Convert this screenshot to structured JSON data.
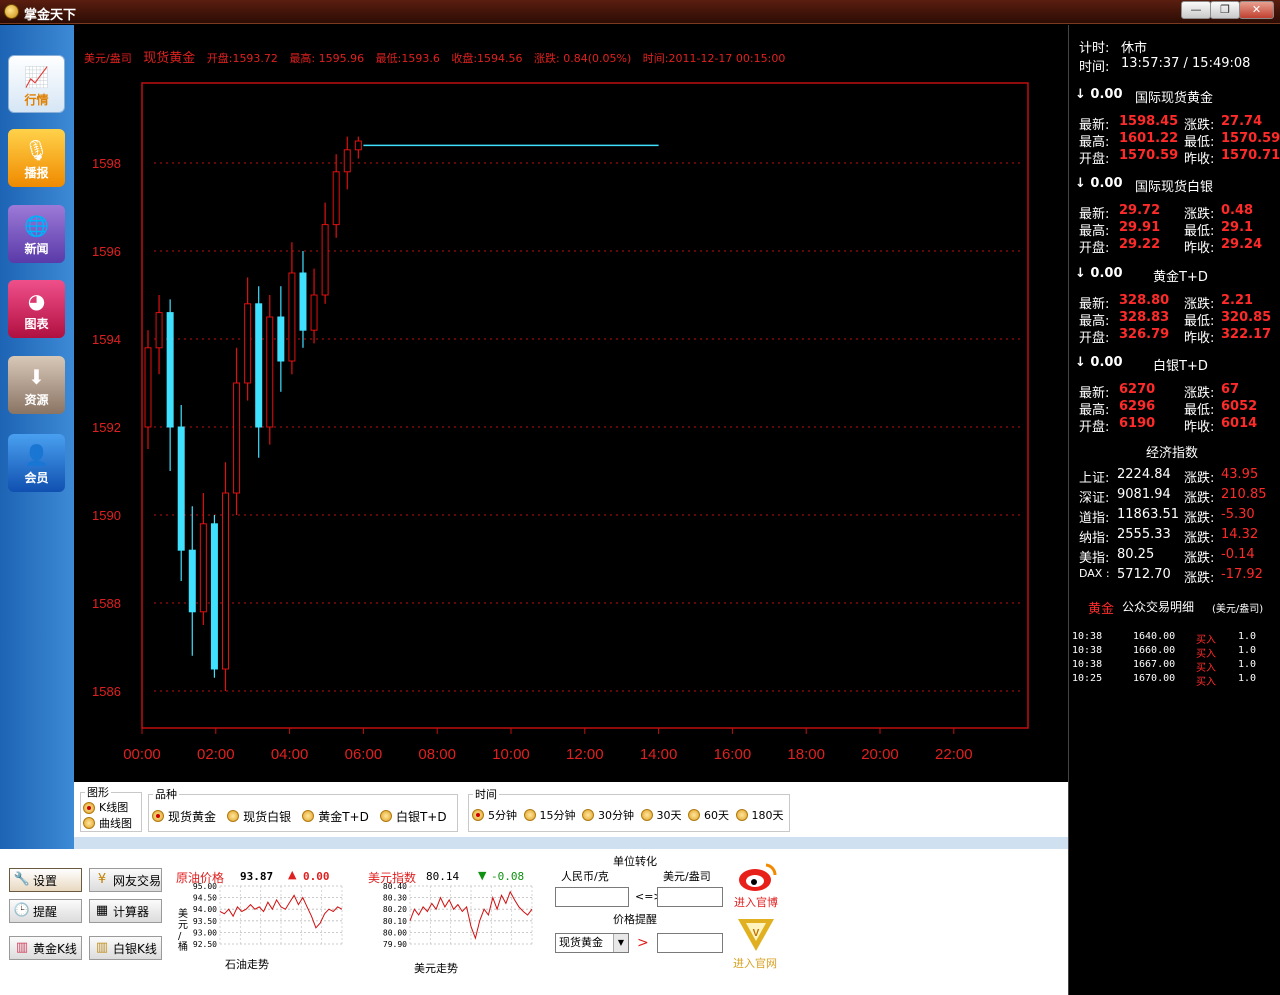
{
  "window": {
    "title": "掌金天下",
    "minimize_label": "—",
    "restore_label": "❐",
    "close_label": "✕"
  },
  "sidebar": {
    "items": [
      {
        "label": "行情",
        "icon": "chart-icon",
        "active": true
      },
      {
        "label": "播报",
        "icon": "microphone-icon"
      },
      {
        "label": "新闻",
        "icon": "globe-icon"
      },
      {
        "label": "图表",
        "icon": "pie-chart-icon"
      },
      {
        "label": "资源",
        "icon": "download-icon"
      },
      {
        "label": "会员",
        "icon": "user-icon"
      }
    ]
  },
  "chart_header": {
    "unit": "美元/盎司",
    "product": "现货黄金",
    "open": "开盘:1593.72",
    "high": "最高: 1595.96",
    "low": "最低:1593.6",
    "close": "收盘:1594.56",
    "change": "涨跌: 0.84(0.05%)",
    "time": "时间:2011-12-17 00:15:00"
  },
  "chart_data": {
    "type": "candlestick",
    "ylim": [
      1585,
      1600
    ],
    "yticks": [
      "1598",
      "1596",
      "1594",
      "1592",
      "1590",
      "1588",
      "1586"
    ],
    "xticks": [
      "00:00",
      "02:00",
      "04:00",
      "06:00",
      "08:00",
      "10:00",
      "12:00",
      "14:00",
      "16:00",
      "18:00",
      "20:00",
      "22:00"
    ],
    "xlim_hours": [
      0,
      24
    ],
    "grid": true,
    "candles_approx": [
      {
        "t": 0.0,
        "o": 1592.0,
        "c": 1593.8,
        "h": 1594.2,
        "l": 1591.5
      },
      {
        "t": 0.3,
        "o": 1593.8,
        "c": 1594.6,
        "h": 1595.0,
        "l": 1593.2
      },
      {
        "t": 0.6,
        "o": 1594.6,
        "c": 1592.0,
        "h": 1594.9,
        "l": 1591.0
      },
      {
        "t": 0.9,
        "o": 1592.0,
        "c": 1589.2,
        "h": 1592.5,
        "l": 1588.5
      },
      {
        "t": 1.2,
        "o": 1589.2,
        "c": 1587.8,
        "h": 1590.2,
        "l": 1586.8
      },
      {
        "t": 1.5,
        "o": 1587.8,
        "c": 1589.8,
        "h": 1590.5,
        "l": 1587.5
      },
      {
        "t": 1.8,
        "o": 1589.8,
        "c": 1586.5,
        "h": 1590.0,
        "l": 1586.3
      },
      {
        "t": 2.1,
        "o": 1586.5,
        "c": 1590.5,
        "h": 1591.2,
        "l": 1586.0
      },
      {
        "t": 2.4,
        "o": 1590.5,
        "c": 1593.0,
        "h": 1593.8,
        "l": 1590.0
      },
      {
        "t": 2.7,
        "o": 1593.0,
        "c": 1594.8,
        "h": 1595.4,
        "l": 1592.6
      },
      {
        "t": 3.0,
        "o": 1594.8,
        "c": 1592.0,
        "h": 1595.2,
        "l": 1591.3
      },
      {
        "t": 3.3,
        "o": 1592.0,
        "c": 1594.5,
        "h": 1595.0,
        "l": 1591.6
      },
      {
        "t": 3.6,
        "o": 1594.5,
        "c": 1593.5,
        "h": 1595.2,
        "l": 1592.8
      },
      {
        "t": 3.9,
        "o": 1593.5,
        "c": 1595.5,
        "h": 1596.2,
        "l": 1593.2
      },
      {
        "t": 4.2,
        "o": 1595.5,
        "c": 1594.2,
        "h": 1596.0,
        "l": 1593.8
      },
      {
        "t": 4.5,
        "o": 1594.2,
        "c": 1595.0,
        "h": 1595.6,
        "l": 1593.9
      },
      {
        "t": 4.8,
        "o": 1595.0,
        "c": 1596.6,
        "h": 1597.1,
        "l": 1594.8
      },
      {
        "t": 5.1,
        "o": 1596.6,
        "c": 1597.8,
        "h": 1598.2,
        "l": 1596.3
      },
      {
        "t": 5.4,
        "o": 1597.8,
        "c": 1598.3,
        "h": 1598.6,
        "l": 1597.4
      },
      {
        "t": 5.7,
        "o": 1598.3,
        "c": 1598.5,
        "h": 1598.6,
        "l": 1598.1
      }
    ],
    "flat_line": {
      "from_hours": 6.0,
      "to_hours": 14.0,
      "value": 1598.4
    }
  },
  "controls": {
    "shape_legend": "图形",
    "shape_options": [
      {
        "label": "K线图",
        "checked": true
      },
      {
        "label": "曲线图",
        "checked": false
      }
    ],
    "variety_legend": "品种",
    "variety_options": [
      {
        "label": "现货黄金",
        "checked": true
      },
      {
        "label": "现货白银",
        "checked": false
      },
      {
        "label": "黄金T+D",
        "checked": false
      },
      {
        "label": "白银T+D",
        "checked": false
      }
    ],
    "time_legend": "时间",
    "time_options": [
      {
        "label": "5分钟",
        "checked": true
      },
      {
        "label": "15分钟",
        "checked": false
      },
      {
        "label": "30分钟",
        "checked": false
      },
      {
        "label": "30天",
        "checked": false
      },
      {
        "label": "60天",
        "checked": false
      },
      {
        "label": "180天",
        "checked": false
      }
    ]
  },
  "toolbar": {
    "buttons": [
      {
        "label": "设置",
        "icon": "wrench-icon"
      },
      {
        "label": "网友交易",
        "icon": "coin-icon"
      },
      {
        "label": "提醒",
        "icon": "clock-icon"
      },
      {
        "label": "计算器",
        "icon": "calculator-icon"
      },
      {
        "label": "黄金K线",
        "icon": "bar-chart-icon"
      },
      {
        "label": "白银K线",
        "icon": "bar-chart-icon"
      }
    ],
    "oil": {
      "title": "原油价格",
      "price": "93.87",
      "change": "0.00",
      "yticks": [
        "95.00",
        "94.50",
        "94.00",
        "93.50",
        "93.00",
        "92.50"
      ],
      "ylabel": "美\n元\n/\n桶",
      "caption": "石油走势",
      "series": [
        93.9,
        93.8,
        94.0,
        93.7,
        94.1,
        93.9,
        94.0,
        94.2,
        94.0,
        94.1,
        93.9,
        94.3,
        94.0,
        94.4,
        94.1,
        94.0,
        94.3,
        94.6,
        94.2,
        94.5,
        94.1,
        93.7,
        93.2,
        93.4,
        93.8,
        94.0,
        93.9,
        94.1,
        94.0
      ]
    },
    "usd": {
      "title": "美元指数",
      "price": "80.14",
      "change": "-0.08",
      "yticks": [
        "80.40",
        "80.30",
        "80.20",
        "80.10",
        "80.00",
        "79.90"
      ],
      "caption": "美元走势",
      "series": [
        80.1,
        80.2,
        80.15,
        80.22,
        80.18,
        80.25,
        80.2,
        80.3,
        80.22,
        80.28,
        80.2,
        80.24,
        80.18,
        80.22,
        80.05,
        79.95,
        80.1,
        80.2,
        80.15,
        80.3,
        80.2,
        80.32,
        80.25,
        80.35,
        80.28,
        80.22,
        80.18,
        80.15,
        80.2
      ]
    },
    "conversion": {
      "title": "单位转化",
      "left_unit": "人民币/克",
      "right_unit": "美元/盎司",
      "arrow": "<=>",
      "alert_title": "价格提醒",
      "alert_select": "现货黄金",
      "alert_gt": ">"
    },
    "weibo_label": "进入官博",
    "site_label": "进入官网"
  },
  "right_panel": {
    "timer_label": "计时:",
    "timer_value": "休市",
    "time_label": "时间:",
    "time_value": "13:57:37 / 15:49:08",
    "quotes": [
      {
        "delta": "↓ 0.00",
        "name": "国际现货黄金",
        "latest": "1598.45",
        "change": "27.74",
        "high": "1601.22",
        "low": "1570.59",
        "open": "1570.59",
        "prev": "1570.71"
      },
      {
        "delta": "↓ 0.00",
        "name": "国际现货白银",
        "latest": "29.72",
        "change": "0.48",
        "high": "29.91",
        "low": "29.1",
        "open": "29.22",
        "prev": "29.24"
      },
      {
        "delta": "↓ 0.00",
        "name": "黄金T+D",
        "latest": "328.80",
        "change": "2.21",
        "high": "328.83",
        "low": "320.85",
        "open": "326.79",
        "prev": "322.17"
      },
      {
        "delta": "↓ 0.00",
        "name": "白银T+D",
        "latest": "6270",
        "change": "67",
        "high": "6296",
        "low": "6052",
        "open": "6190",
        "prev": "6014"
      }
    ],
    "labels": {
      "latest": "最新:",
      "change": "涨跌:",
      "high": "最高:",
      "low": "最低:",
      "open": "开盘:",
      "prev": "昨收:"
    },
    "econ_title": "经济指数",
    "econ": [
      {
        "name": "上证:",
        "value": "2224.84",
        "chg_label": "涨跌:",
        "chg": "43.95"
      },
      {
        "name": "深证:",
        "value": "9081.94",
        "chg_label": "涨跌:",
        "chg": "210.85"
      },
      {
        "name": "道指:",
        "value": "11863.51",
        "chg_label": "涨跌:",
        "chg": "-5.30"
      },
      {
        "name": "纳指:",
        "value": "2555.33",
        "chg_label": "涨跌:",
        "chg": "14.32"
      },
      {
        "name": "美指:",
        "value": "80.25",
        "chg_label": "涨跌:",
        "chg": "-0.14"
      },
      {
        "name": "DAX :",
        "value": "5712.70",
        "chg_label": "涨跌:",
        "chg": "-17.92"
      }
    ],
    "trade_title_red": "黄金",
    "trade_title": "公众交易明细",
    "trade_unit": "(美元/盎司)",
    "trades": [
      {
        "time": "10:38",
        "price": "1640.00",
        "side": "买入",
        "qty": "1.0"
      },
      {
        "time": "10:38",
        "price": "1660.00",
        "side": "买入",
        "qty": "1.0"
      },
      {
        "time": "10:38",
        "price": "1667.00",
        "side": "买入",
        "qty": "1.0"
      },
      {
        "time": "10:25",
        "price": "1670.00",
        "side": "买入",
        "qty": "1.0"
      }
    ]
  },
  "colors": {
    "up": "#e01010",
    "down": "#40e0ff",
    "grid": "#c01010",
    "axis_text": "#e02020"
  }
}
